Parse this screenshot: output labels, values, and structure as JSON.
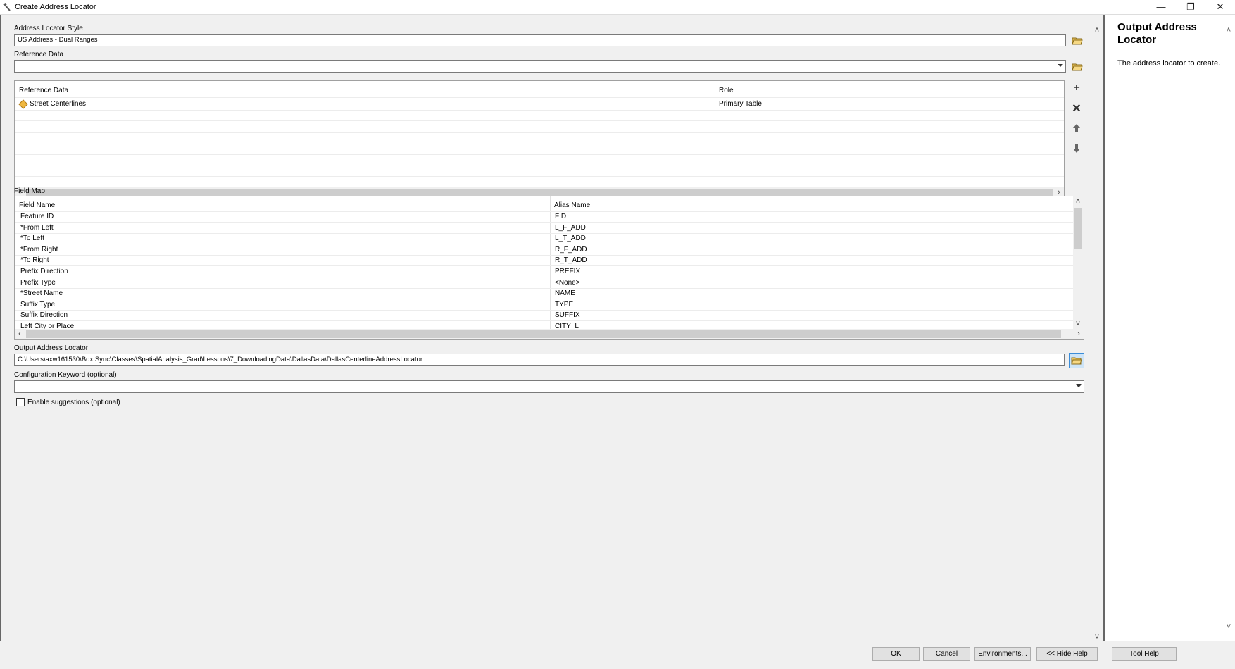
{
  "window": {
    "title": "Create Address Locator",
    "minimize_glyph": "—",
    "restore_glyph": "❐",
    "close_glyph": "✕"
  },
  "address_locator_style": {
    "label": "Address Locator Style",
    "value": "US Address - Dual Ranges"
  },
  "reference_data": {
    "label": "Reference Data",
    "value": ""
  },
  "reference_table": {
    "headers": [
      "Reference Data",
      "Role"
    ],
    "rows": [
      {
        "data": "Street Centerlines",
        "role": "Primary Table"
      }
    ]
  },
  "field_map": {
    "label": "Field Map",
    "headers": [
      "Field Name",
      "Alias Name"
    ],
    "rows": [
      {
        "field": "Feature ID",
        "alias": "FID"
      },
      {
        "field": "*From Left",
        "alias": "L_F_ADD"
      },
      {
        "field": "*To Left",
        "alias": "L_T_ADD"
      },
      {
        "field": "*From Right",
        "alias": "R_F_ADD"
      },
      {
        "field": "*To Right",
        "alias": "R_T_ADD"
      },
      {
        "field": "Prefix Direction",
        "alias": "PREFIX"
      },
      {
        "field": "Prefix Type",
        "alias": "<None>"
      },
      {
        "field": "*Street Name",
        "alias": "NAME"
      },
      {
        "field": "Suffix Type",
        "alias": "TYPE"
      },
      {
        "field": "Suffix Direction",
        "alias": "SUFFIX"
      },
      {
        "field": "Left City or Place",
        "alias": "CITY_L"
      }
    ]
  },
  "output_locator": {
    "label": "Output Address Locator",
    "value": "C:\\Users\\axw161530\\Box Sync\\Classes\\SpatialAnalysis_Grad\\Lessons\\7_DownloadingData\\DallasData\\DallasCenterlineAddressLocator"
  },
  "config_keyword": {
    "label": "Configuration Keyword (optional)",
    "value": ""
  },
  "suggestions": {
    "label": "Enable suggestions (optional)",
    "checked": false
  },
  "help": {
    "title": "Output Address Locator",
    "body": "The address locator to create."
  },
  "buttons": {
    "ok": "OK",
    "cancel": "Cancel",
    "environments": "Environments...",
    "hide_help": "<< Hide Help",
    "tool_help": "Tool Help"
  },
  "colors": {
    "accent": "#3c8dd8",
    "folder": "#e8c15a",
    "feature_icon": "#f0b840"
  }
}
